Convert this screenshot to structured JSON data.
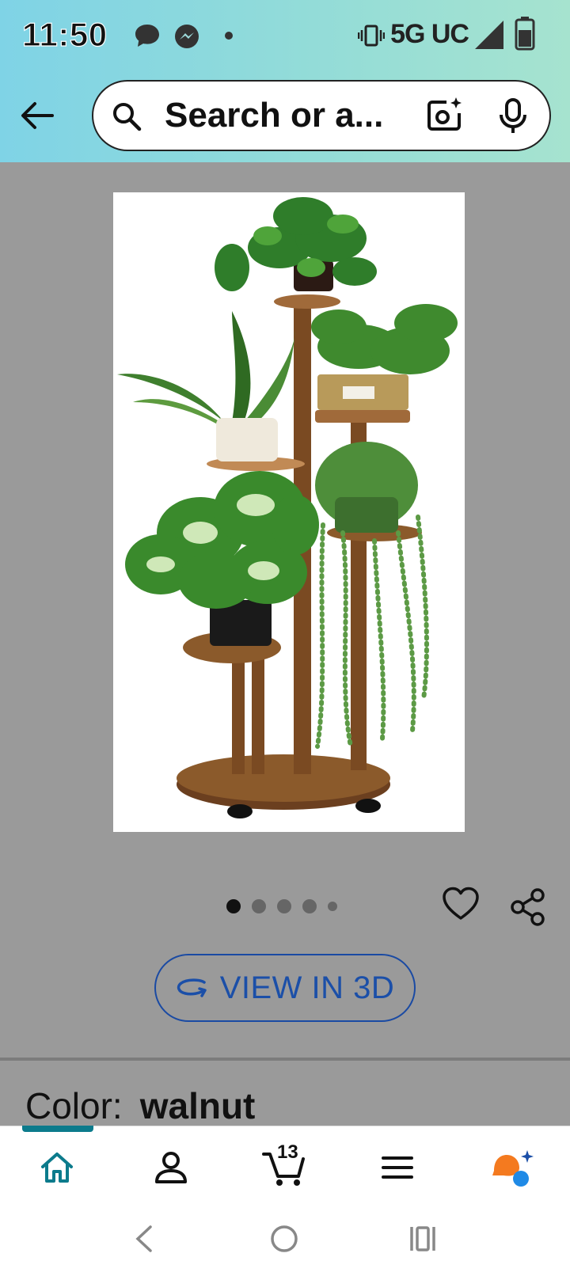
{
  "status_bar": {
    "time": "11:50",
    "network": "5G UC"
  },
  "search": {
    "placeholder": "Search or a..."
  },
  "gallery": {
    "image_count": 5,
    "active_index": 0
  },
  "actions": {
    "view_3d_label": "VIEW IN 3D"
  },
  "product": {
    "color_label": "Color:",
    "color_value": "walnut"
  },
  "bottom_nav": {
    "cart_count": "13",
    "items": [
      "home",
      "account",
      "cart",
      "menu",
      "rufus"
    ]
  },
  "colors": {
    "header_gradient_start": "#7fd3e6",
    "header_gradient_end": "#a6e3cf",
    "accent_teal": "#0c7b8c",
    "view3d_blue": "#1b4fa8",
    "overlay_gray": "#9a9a9a"
  }
}
